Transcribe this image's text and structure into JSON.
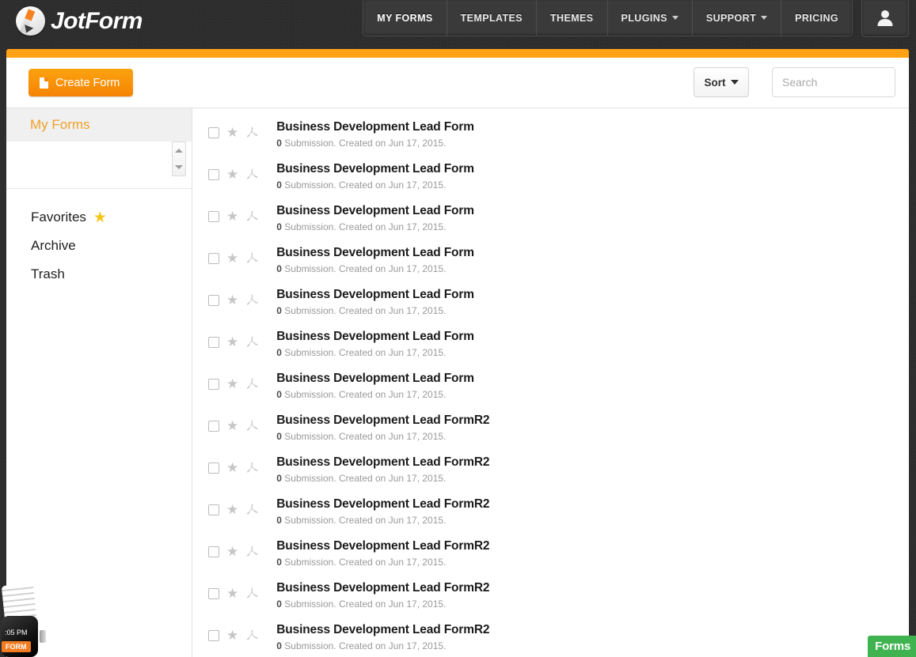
{
  "brand": {
    "name": "JotForm",
    "logo_icon": "pencil-circle-icon",
    "accent_color": "#ffa216",
    "orange_button_color": "#f78a06"
  },
  "nav": {
    "items": [
      {
        "label": "MY FORMS",
        "has_caret": false,
        "active": true
      },
      {
        "label": "TEMPLATES",
        "has_caret": false,
        "active": false
      },
      {
        "label": "THEMES",
        "has_caret": false,
        "active": false
      },
      {
        "label": "PLUGINS",
        "has_caret": true,
        "active": false
      },
      {
        "label": "SUPPORT",
        "has_caret": true,
        "active": false
      },
      {
        "label": "PRICING",
        "has_caret": false,
        "active": false
      }
    ],
    "avatar_icon": "user-avatar-icon"
  },
  "toolbar": {
    "create_label": "Create Form",
    "create_icon": "document-icon",
    "sort_label": "Sort",
    "sort_icon": "chevron-down-icon",
    "search_placeholder": "Search",
    "search_value": ""
  },
  "sidebar": {
    "active_folder": "My Forms",
    "items": [
      {
        "label": "Favorites",
        "icon": "star-filled-icon"
      },
      {
        "label": "Archive",
        "icon": ""
      },
      {
        "label": "Trash",
        "icon": ""
      }
    ],
    "spinner": {
      "up_icon": "triangle-up-icon",
      "down_icon": "triangle-down-icon"
    }
  },
  "forms": {
    "row_icons": {
      "checkbox": "checkbox-icon",
      "favorite": "star-outline-icon",
      "pdf": "pdf-acrobat-icon"
    },
    "rows": [
      {
        "title": "Business Development Lead Form",
        "count": "0",
        "meta": "Submission. Created on Jun 17, 2015."
      },
      {
        "title": "Business Development Lead Form",
        "count": "0",
        "meta": "Submission. Created on Jun 17, 2015."
      },
      {
        "title": "Business Development Lead Form",
        "count": "0",
        "meta": "Submission. Created on Jun 17, 2015."
      },
      {
        "title": "Business Development Lead Form",
        "count": "0",
        "meta": "Submission. Created on Jun 17, 2015."
      },
      {
        "title": "Business Development Lead Form",
        "count": "0",
        "meta": "Submission. Created on Jun 17, 2015."
      },
      {
        "title": "Business Development Lead Form",
        "count": "0",
        "meta": "Submission. Created on Jun 17, 2015."
      },
      {
        "title": "Business Development Lead Form",
        "count": "0",
        "meta": "Submission. Created on Jun 17, 2015."
      },
      {
        "title": "Business Development Lead FormR2",
        "count": "0",
        "meta": "Submission. Created on Jun 17, 2015."
      },
      {
        "title": "Business Development Lead FormR2",
        "count": "0",
        "meta": "Submission. Created on Jun 17, 2015."
      },
      {
        "title": "Business Development Lead FormR2",
        "count": "0",
        "meta": "Submission. Created on Jun 17, 2015."
      },
      {
        "title": "Business Development Lead FormR2",
        "count": "0",
        "meta": "Submission. Created on Jun 17, 2015."
      },
      {
        "title": "Business Development Lead FormR2",
        "count": "0",
        "meta": "Submission. Created on Jun 17, 2015."
      },
      {
        "title": "Business Development Lead FormR2",
        "count": "0",
        "meta": "Submission. Created on Jun 17, 2015."
      }
    ]
  },
  "overlays": {
    "watch_promo": {
      "time": ":05 PM",
      "cta": "FORM"
    },
    "forms_badge": {
      "label": "Forms",
      "color": "#3eb34f"
    }
  }
}
